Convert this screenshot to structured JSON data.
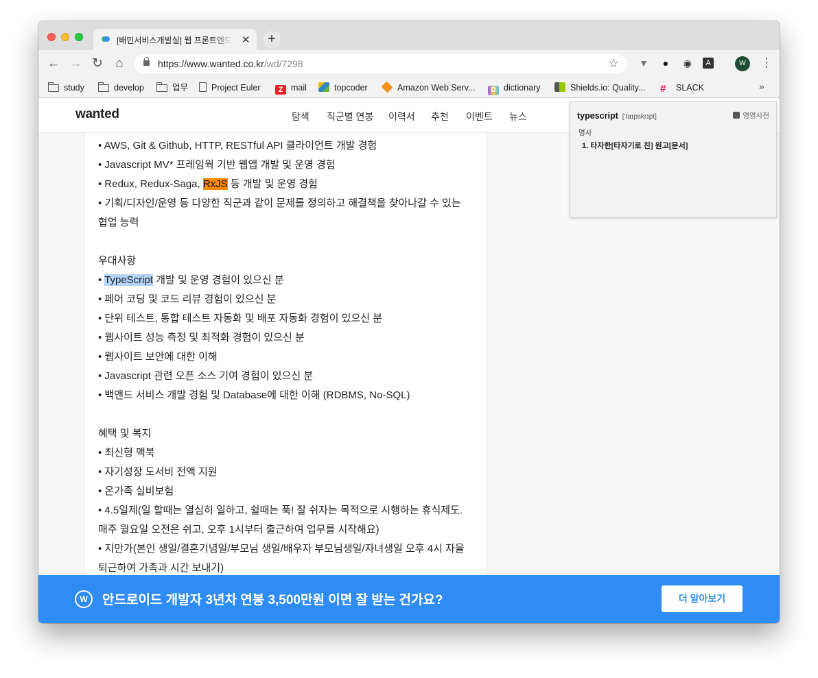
{
  "tab": {
    "title": "[배민서비스개발실] 웹 프론트엔드 개발자",
    "close": "✕"
  },
  "newtab": "+",
  "omnibox": {
    "url_host": "https://www.wanted.co.kr",
    "url_path": "/wd/7298"
  },
  "bookmarks": [
    {
      "label": "study",
      "icon": "folder-icon"
    },
    {
      "label": "develop",
      "icon": "folder-icon"
    },
    {
      "label": "업무",
      "icon": "folder-icon"
    },
    {
      "label": "Project Euler",
      "icon": "page-icon"
    },
    {
      "label": "mail",
      "icon": "zoho-icon"
    },
    {
      "label": "topcoder",
      "icon": "topcoder-icon"
    },
    {
      "label": "Amazon Web Serv...",
      "icon": "aws-icon"
    },
    {
      "label": "dictionary",
      "icon": "dictionary-icon"
    },
    {
      "label": "Shields.io: Quality...",
      "icon": "shields-icon"
    },
    {
      "label": "SLACK",
      "icon": "slack-icon"
    }
  ],
  "profile_initial": "W",
  "site": {
    "logo": "wanted",
    "nav": [
      "탐색",
      "직군별 연봉",
      "이력서",
      "추천",
      "이벤트",
      "뉴스"
    ]
  },
  "content": {
    "l1": "• AWS, Git & Github, HTTP, RESTful API 클라이언트 개발 경험",
    "l2": "• Javascript MV* 프레임웍 기반 웹앱 개발 및 운영 경험",
    "l3_pre": "• Redux, Redux-Saga, ",
    "l3_hl": "RxJS",
    "l3_post": " 등 개발 및 운영 경험",
    "l4": "• 기획/디자인/운영 등 다양한 직군과 같이 문제를 정의하고 해결책을 찾아나갈 수 있는",
    "l5": "협업 능력",
    "pref_title": "우대사항",
    "p1_pre": "• ",
    "p1_hl": "TypeScript",
    "p1_post": " 개발 및 운영 경험이 있으신 분",
    "p2": "• 페어 코딩 및 코드 리뷰 경험이 있으신 분",
    "p3": "• 단위 테스트, 통합 테스트 자동화 및 배포 자동화 경험이 있으신 분",
    "p4": "• 웹사이트 성능 측정 및 최적화 경험이 있으신 분",
    "p5": "• 웹사이트 보안에 대한 이해",
    "p6": "• Javascript 관련 오픈 소스 기여 경험이 있으신 분",
    "p7": "• 백앤드 서비스 개발 경험 및 Database에 대한 이해 (RDBMS, No-SQL)",
    "benefit_title": "혜택 및 복지",
    "b1": "• 최신형 맥북",
    "b2": "• 자기성장 도서비 전액 지원",
    "b3": "• 온가족 실비보험",
    "b4": "• 4.5일제(일 할때는 열심히 일하고, 쉴때는 푹! 잘 쉬자는 목적으로 시행하는 휴식제도.",
    "b5": "매주 월요일 오전은 쉬고, 오후 1시부터 출근하여 업무를 시작해요)",
    "b6": "• 지만가(본인 생일/결혼기념일/부모님 생일/배우자 부모님생일/자녀생일 오후 4시 자율",
    "b7": "퇴근하여 가족과 시간 보내기)"
  },
  "dict": {
    "word": "typescript",
    "pron": "['taɪpskrɪpt]",
    "source": "영영사전",
    "pos": "명사",
    "def": "1. 타자한[타자기로 친] 원고[문서]"
  },
  "banner": {
    "text": "안드로이드 개발자 3년차 연봉 3,500만원 이면 잘 받는 건가요?",
    "button": "더 알아보기",
    "color": "#2f8cf4"
  }
}
